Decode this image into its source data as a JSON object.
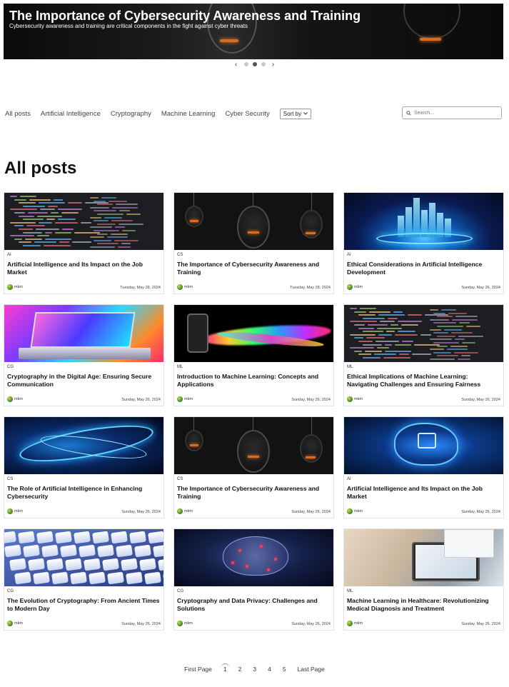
{
  "hero": {
    "title": "The Importance of Cybersecurity Awareness and Training",
    "subtitle": "Cybersecurity awareness and training are critical components in the fight against cyber threats",
    "prev_icon": "chevron-left-icon",
    "next_icon": "chevron-right-icon",
    "slides": 3,
    "active_slide": 2
  },
  "filters": {
    "items": [
      "All posts",
      "Artificial Intelligence",
      "Cryptography",
      "Machine Learning",
      "Cyber Security"
    ],
    "sort_label": "Sort by",
    "search_placeholder": "Search..."
  },
  "page_heading": "All posts",
  "posts": [
    {
      "category": "AI",
      "title": "Artificial Intelligence and Its Impact on the Job Market",
      "author": "mkm",
      "date": "Tuesday, May 28, 2024",
      "image": "code"
    },
    {
      "category": "CS",
      "title": "The Importance of Cybersecurity Awareness and Training",
      "author": "mkm",
      "date": "Tuesday, May 28, 2024",
      "image": "bulb"
    },
    {
      "category": "AI",
      "title": "Ethical Considerations in Artificial Intelligence Development",
      "author": "mkm",
      "date": "Sunday, May 26, 2024",
      "image": "city"
    },
    {
      "category": "CG",
      "title": "Cryptography in the Digital Age: Ensuring Secure Communication",
      "author": "mkm",
      "date": "Sunday, May 26, 2024",
      "image": "laptop"
    },
    {
      "category": "ML",
      "title": "Introduction to Machine Learning: Concepts and Applications",
      "author": "mkm",
      "date": "Sunday, May 26, 2024",
      "image": "wave"
    },
    {
      "category": "ML",
      "title": "Ethical Implications of Machine Learning: Navigating Challenges and Ensuring Fairness",
      "author": "mkm",
      "date": "Sunday, May 26, 2024",
      "image": "code"
    },
    {
      "category": "CS",
      "title": "The Role of Artificial Intelligence in Enhancing Cybersecurity",
      "author": "mkm",
      "date": "Sunday, May 26, 2024",
      "image": "ai1"
    },
    {
      "category": "CS",
      "title": "The Importance of Cybersecurity Awareness and Training",
      "author": "mkm",
      "date": "Sunday, May 26, 2024",
      "image": "bulb"
    },
    {
      "category": "AI",
      "title": "Artificial Intelligence and Its Impact on the Job Market",
      "author": "mkm",
      "date": "Sunday, May 26, 2024",
      "image": "ai2"
    },
    {
      "category": "CG",
      "title": "The Evolution of Cryptography: From Ancient Times to Modern Day",
      "author": "mkm",
      "date": "Sunday, May 26, 2024",
      "image": "keys"
    },
    {
      "category": "CG",
      "title": "Cryptography and Data Privacy: Challenges and Solutions",
      "author": "mkm",
      "date": "Sunday, May 26, 2024",
      "image": "brain"
    },
    {
      "category": "ML",
      "title": "Machine Learning in Healthcare: Revolutionizing Medical Diagnosis and Treatment",
      "author": "mkm",
      "date": "Sunday, May 26, 2024",
      "image": "health"
    }
  ],
  "pagination": {
    "first": "First Page",
    "pages": [
      "1",
      "2",
      "3",
      "4",
      "5"
    ],
    "active": "1",
    "last": "Last Page"
  }
}
